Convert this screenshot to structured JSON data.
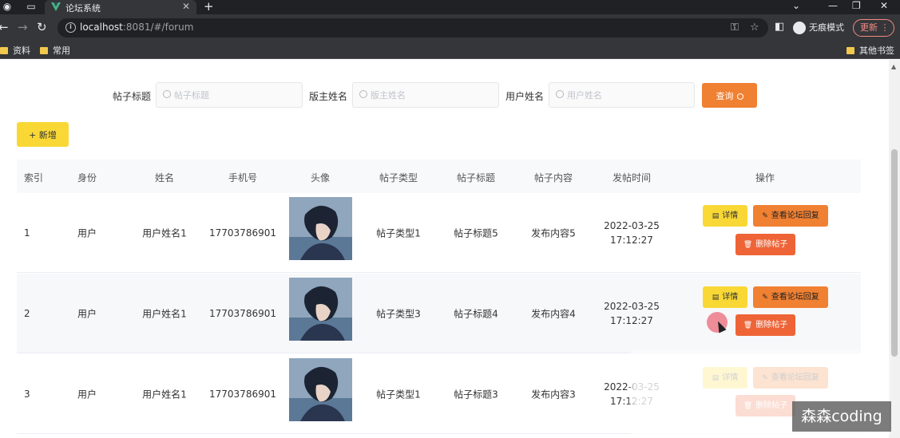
{
  "browser": {
    "tab_title": "论坛系统",
    "url_host": "localhost",
    "url_rest": ":8081/#/forum",
    "incognito_label": "无痕模式",
    "update_label": "更新",
    "bookmarks": [
      "资料",
      "常用"
    ],
    "other_bookmarks": "其他书签"
  },
  "search": {
    "title_label": "帖子标题",
    "title_placeholder": "帖子标题",
    "moderator_label": "版主姓名",
    "moderator_placeholder": "版主姓名",
    "user_label": "用户姓名",
    "user_placeholder": "用户姓名",
    "query_label": "查询"
  },
  "add_label": "+ 新增",
  "table": {
    "headers": [
      "索引",
      "身份",
      "姓名",
      "手机号",
      "头像",
      "帖子类型",
      "帖子标题",
      "帖子内容",
      "发帖时间",
      "操作"
    ],
    "rows": [
      {
        "index": "1",
        "role": "用户",
        "name": "用户姓名1",
        "phone": "17703786901",
        "type": "帖子类型1",
        "title": "帖子标题5",
        "content": "发布内容5",
        "time": "2022-03-25 17:12:27"
      },
      {
        "index": "2",
        "role": "用户",
        "name": "用户姓名1",
        "phone": "17703786901",
        "type": "帖子类型3",
        "title": "帖子标题4",
        "content": "发布内容4",
        "time": "2022-03-25 17:12:27"
      },
      {
        "index": "3",
        "role": "用户",
        "name": "用户姓名1",
        "phone": "17703786901",
        "type": "帖子类型1",
        "title": "帖子标题3",
        "content": "发布内容3",
        "time": "2022-03-25 17:12:27"
      }
    ],
    "actions": {
      "detail": "详情",
      "reply": "查看论坛回复",
      "delete": "删除帖子"
    }
  },
  "watermark": "森森coding",
  "colors": {
    "query": "#f08032",
    "add": "#f9d835",
    "delete": "#ee6437"
  }
}
